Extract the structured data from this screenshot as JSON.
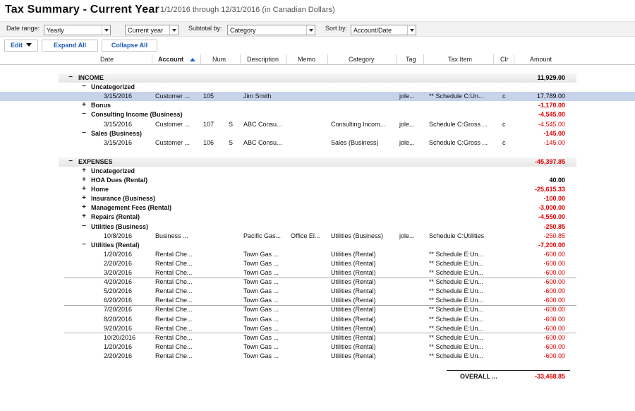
{
  "window": {
    "title": "Tax Summary - Current Year",
    "subtitle": "1/1/2016 through 12/31/2016  (in Canadian Dollars)"
  },
  "filters": {
    "date_range_label": "Date range:",
    "date_range_value": "Yearly",
    "period_value": "Current year",
    "subtotal_label": "Subtotal by:",
    "subtotal_value": "Category",
    "sort_label": "Sort by:",
    "sort_value": "Account/Date"
  },
  "toolbar": {
    "edit_label": "Edit",
    "expand_label": "Expand All",
    "collapse_label": "Collapse All"
  },
  "columns": [
    "Date",
    "Account",
    "Num",
    "Description",
    "Memo",
    "Category",
    "Tag",
    "Tax Item",
    "Clr",
    "Amount"
  ],
  "income": {
    "label": "INCOME",
    "expander": "−",
    "total": "11,929.00",
    "groups": [
      {
        "label": "Uncategorized",
        "expander": "−",
        "total": "",
        "rows": [
          {
            "date": "3/15/2016",
            "account": "Customer ...",
            "num": "105",
            "s": "",
            "description": "Jim Smith",
            "memo": "",
            "category": "",
            "tag": "jole...",
            "taxitem": "** Schedule C:Un...",
            "clr": "c",
            "amount": "17,789.00",
            "neg": false,
            "selected": true
          }
        ]
      },
      {
        "label": "Bonus",
        "expander": "+",
        "total": "-1,170.00",
        "rows": []
      },
      {
        "label": "Consulting Income (Business)",
        "expander": "−",
        "total": "-4,545.00",
        "rows": [
          {
            "date": "3/15/2016",
            "account": "Customer ...",
            "num": "107",
            "s": "S",
            "description": "ABC Consu...",
            "memo": "",
            "category": "Consulting Incom...",
            "tag": "jole...",
            "taxitem": "Schedule C:Gross ...",
            "clr": "c",
            "amount": "-4,545.00",
            "neg": true,
            "selected": false
          }
        ]
      },
      {
        "label": "Sales (Business)",
        "expander": "−",
        "total": "-145.00",
        "rows": [
          {
            "date": "3/15/2016",
            "account": "Customer ...",
            "num": "106",
            "s": "S",
            "description": "ABC Consu...",
            "memo": "",
            "category": "Sales (Business)",
            "tag": "jole...",
            "taxitem": "Schedule C:Gross ...",
            "clr": "c",
            "amount": "-145.00",
            "neg": true,
            "selected": false
          }
        ]
      }
    ]
  },
  "expenses": {
    "label": "EXPENSES",
    "expander": "−",
    "total": "-45,397.85",
    "groups": [
      {
        "label": "Uncategorized",
        "expander": "+",
        "total": "",
        "rows": []
      },
      {
        "label": "HOA Dues (Rental)",
        "expander": "+",
        "total": "40.00",
        "rows": []
      },
      {
        "label": "Home",
        "expander": "+",
        "total": "-25,615.33",
        "rows": []
      },
      {
        "label": "Insurance (Business)",
        "expander": "+",
        "total": "-100.00",
        "rows": []
      },
      {
        "label": "Management Fees (Rental)",
        "expander": "+",
        "total": "-3,000.00",
        "rows": []
      },
      {
        "label": "Repairs (Rental)",
        "expander": "+",
        "total": "-4,550.00",
        "rows": []
      },
      {
        "label": "Utilities (Business)",
        "expander": "−",
        "total": "-250.85",
        "rows": [
          {
            "date": "10/8/2016",
            "account": "Business ...",
            "num": "",
            "s": "",
            "description": "Pacific Gas...",
            "memo": "Office El...",
            "category": "Utilities (Business)",
            "tag": "jole...",
            "taxitem": "Schedule C:Utilities",
            "clr": "",
            "amount": "-250.85",
            "neg": true,
            "selected": false
          }
        ]
      },
      {
        "label": "Utilities (Rental)",
        "expander": "−",
        "total": "-7,200.00",
        "rows": [
          {
            "date": "1/20/2016",
            "account": "Rental Che...",
            "num": "",
            "s": "",
            "description": "Town Gas ...",
            "memo": "",
            "category": "Utilities (Rental)",
            "tag": "",
            "taxitem": "** Schedule E:Un...",
            "clr": "",
            "amount": "-600.00",
            "neg": true,
            "selected": false
          },
          {
            "date": "2/20/2016",
            "account": "Rental Che...",
            "num": "",
            "s": "",
            "description": "Town Gas ...",
            "memo": "",
            "category": "Utilities (Rental)",
            "tag": "",
            "taxitem": "** Schedule E:Un...",
            "clr": "",
            "amount": "-600.00",
            "neg": true,
            "selected": false
          },
          {
            "date": "3/20/2016",
            "account": "Rental Che...",
            "num": "",
            "s": "",
            "description": "Town Gas ...",
            "memo": "",
            "category": "Utilities (Rental)",
            "tag": "",
            "taxitem": "** Schedule E:Un...",
            "clr": "",
            "amount": "-600.00",
            "neg": true,
            "selected": false
          },
          {
            "date": "4/20/2016",
            "account": "Rental Che...",
            "num": "",
            "s": "",
            "description": "Town Gas ...",
            "memo": "",
            "category": "Utilities (Rental)",
            "tag": "",
            "taxitem": "** Schedule E:Un...",
            "clr": "",
            "amount": "-600.00",
            "neg": true,
            "selected": false
          },
          {
            "date": "5/20/2016",
            "account": "Rental Che...",
            "num": "",
            "s": "",
            "description": "Town Gas ...",
            "memo": "",
            "category": "Utilities (Rental)",
            "tag": "",
            "taxitem": "** Schedule E:Un...",
            "clr": "",
            "amount": "-600.00",
            "neg": true,
            "selected": false
          },
          {
            "date": "6/20/2016",
            "account": "Rental Che...",
            "num": "",
            "s": "",
            "description": "Town Gas ...",
            "memo": "",
            "category": "Utilities (Rental)",
            "tag": "",
            "taxitem": "** Schedule E:Un...",
            "clr": "",
            "amount": "-600.00",
            "neg": true,
            "selected": false
          },
          {
            "date": "7/20/2016",
            "account": "Rental Che...",
            "num": "",
            "s": "",
            "description": "Town Gas ...",
            "memo": "",
            "category": "Utilities (Rental)",
            "tag": "",
            "taxitem": "** Schedule E:Un...",
            "clr": "",
            "amount": "-600.00",
            "neg": true,
            "selected": false
          },
          {
            "date": "8/20/2016",
            "account": "Rental Che...",
            "num": "",
            "s": "",
            "description": "Town Gas ...",
            "memo": "",
            "category": "Utilities (Rental)",
            "tag": "",
            "taxitem": "** Schedule E:Un...",
            "clr": "",
            "amount": "-600.00",
            "neg": true,
            "selected": false
          },
          {
            "date": "9/20/2016",
            "account": "Rental Che...",
            "num": "",
            "s": "",
            "description": "Town Gas ...",
            "memo": "",
            "category": "Utilities (Rental)",
            "tag": "",
            "taxitem": "** Schedule E:Un...",
            "clr": "",
            "amount": "-600.00",
            "neg": true,
            "selected": false
          },
          {
            "date": "10/20/2016",
            "account": "Rental Che...",
            "num": "",
            "s": "",
            "description": "Town Gas ...",
            "memo": "",
            "category": "Utilities (Rental)",
            "tag": "",
            "taxitem": "** Schedule E:Un...",
            "clr": "",
            "amount": "-600.00",
            "neg": true,
            "selected": false
          },
          {
            "date": "1/20/2016",
            "account": "Rental Che...",
            "num": "",
            "s": "",
            "description": "Town Gas ...",
            "memo": "",
            "category": "Utilities (Rental)",
            "tag": "",
            "taxitem": "** Schedule E:Un...",
            "clr": "",
            "amount": "-600.00",
            "neg": true,
            "selected": false
          },
          {
            "date": "2/20/2016",
            "account": "Rental Che...",
            "num": "",
            "s": "",
            "description": "Town Gas ...",
            "memo": "",
            "category": "Utilities (Rental)",
            "tag": "",
            "taxitem": "** Schedule E:Un...",
            "clr": "",
            "amount": "-600.00",
            "neg": true,
            "selected": false
          }
        ]
      }
    ]
  },
  "overall": {
    "label": "OVERALL ...",
    "total": "-33,468.85"
  }
}
